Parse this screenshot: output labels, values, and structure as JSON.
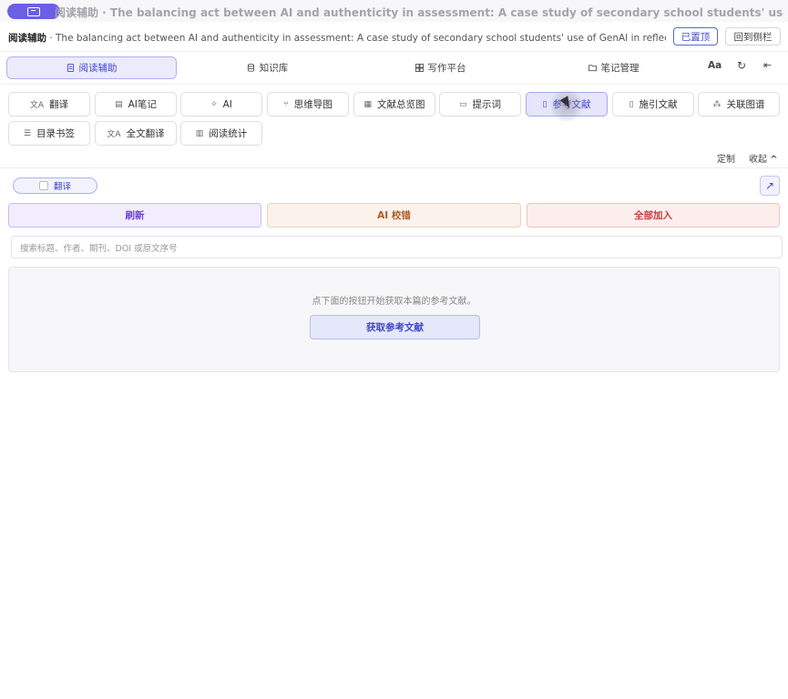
{
  "window": {
    "title": "阅读辅助 · The balancing act between AI and authenticity in assessment: A case study of secondary school students' use of GenAI in reflective wr..."
  },
  "doc_header": {
    "label": "阅读辅助",
    "title": "· The balancing act between AI and authenticity in assessment: A case study of secondary school students' use of GenAI in reflective wri...",
    "pinned_label": "已置顶",
    "back_to_sidebar_label": "回到侧栏"
  },
  "main_tabs": [
    {
      "label": "阅读辅助",
      "icon": "document-icon",
      "active": true
    },
    {
      "label": "知识库",
      "icon": "database-icon",
      "active": false
    },
    {
      "label": "写作平台",
      "icon": "grid-icon",
      "active": false
    },
    {
      "label": "笔记管理",
      "icon": "folder-icon",
      "active": false
    }
  ],
  "tab_tools": {
    "font_label": "Aa",
    "refresh_icon": "refresh-icon",
    "collapse_icon": "collapse-left-icon"
  },
  "tools": [
    {
      "label": "翻译",
      "glyph": "文A",
      "icon": "translate-icon"
    },
    {
      "label": "AI笔记",
      "glyph": "▤",
      "icon": "note-icon"
    },
    {
      "label": "AI",
      "glyph": "✧",
      "icon": "sparkle-icon"
    },
    {
      "label": "思维导图",
      "glyph": "⑂",
      "icon": "mindmap-icon"
    },
    {
      "label": "文献总览图",
      "glyph": "▦",
      "icon": "overview-icon"
    },
    {
      "label": "提示词",
      "glyph": "▭",
      "icon": "prompt-icon"
    },
    {
      "label": "参考文献",
      "glyph": "▯",
      "icon": "reference-icon",
      "active": true
    },
    {
      "label": "施引文献",
      "glyph": "▯",
      "icon": "citing-icon"
    },
    {
      "label": "关联图谱",
      "glyph": "⁂",
      "icon": "graph-icon"
    },
    {
      "label": "目录书签",
      "glyph": "☰",
      "icon": "toc-icon"
    },
    {
      "label": "全文翻译",
      "glyph": "文A",
      "icon": "fulltext-translate-icon"
    },
    {
      "label": "阅读统计",
      "glyph": "▥",
      "icon": "stats-icon"
    }
  ],
  "panel_controls": {
    "customize_label": "定制",
    "collapse_label": "收起",
    "collapse_arrow": "^"
  },
  "references": {
    "translate_toggle_label": "翻译",
    "translate_checked": false,
    "expand_icon": "↗",
    "refresh_label": "刷新",
    "ai_check_label": "AI 校错",
    "add_all_label": "全部加入",
    "search_placeholder": "搜索标题、作者、期刊、DOI 或原文序号",
    "empty_hint": "点下面的按钮开始获取本篇的参考文献。",
    "fetch_label": "获取参考文献"
  },
  "colors": {
    "accent": "#3f48c8",
    "pill": "#6b5fe6",
    "refresh": "#6d3fd8",
    "ai_check": "#b05b24",
    "add_all": "#cc3a3a"
  }
}
